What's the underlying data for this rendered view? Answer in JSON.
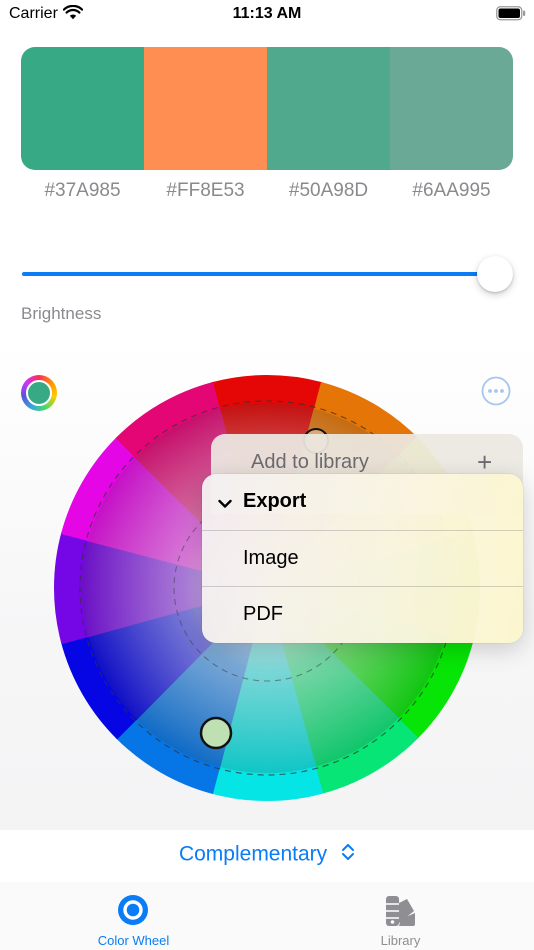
{
  "status_bar": {
    "carrier": "Carrier",
    "time": "11:13 AM",
    "icons": [
      "wifi-icon",
      "battery-icon"
    ]
  },
  "palette": {
    "swatches": [
      {
        "hex": "#37A985",
        "color": "#37a985"
      },
      {
        "hex": "#FF8E53",
        "color": "#ff8e53"
      },
      {
        "hex": "#50A98D",
        "color": "#50a98d"
      },
      {
        "hex": "#6AA995",
        "color": "#6aa995"
      }
    ]
  },
  "brightness": {
    "label": "Brightness",
    "value": 1.0,
    "accent": "#0a7cf6"
  },
  "wheel": {
    "current_color": "#37a985",
    "icons": [
      "color-ring-icon",
      "more-icon"
    ]
  },
  "context_menu": {
    "header_item": "Add to library",
    "header_icon": "plus-icon",
    "section_title": "Export",
    "items": [
      "Image",
      "PDF"
    ]
  },
  "harmony": {
    "label": "Complementary",
    "icon": "chevron-up-down-icon"
  },
  "tab_bar": {
    "tabs": [
      {
        "label": "Color Wheel",
        "icon": "color-wheel-icon",
        "active": true
      },
      {
        "label": "Library",
        "icon": "swatchbook-icon",
        "active": false
      }
    ]
  }
}
